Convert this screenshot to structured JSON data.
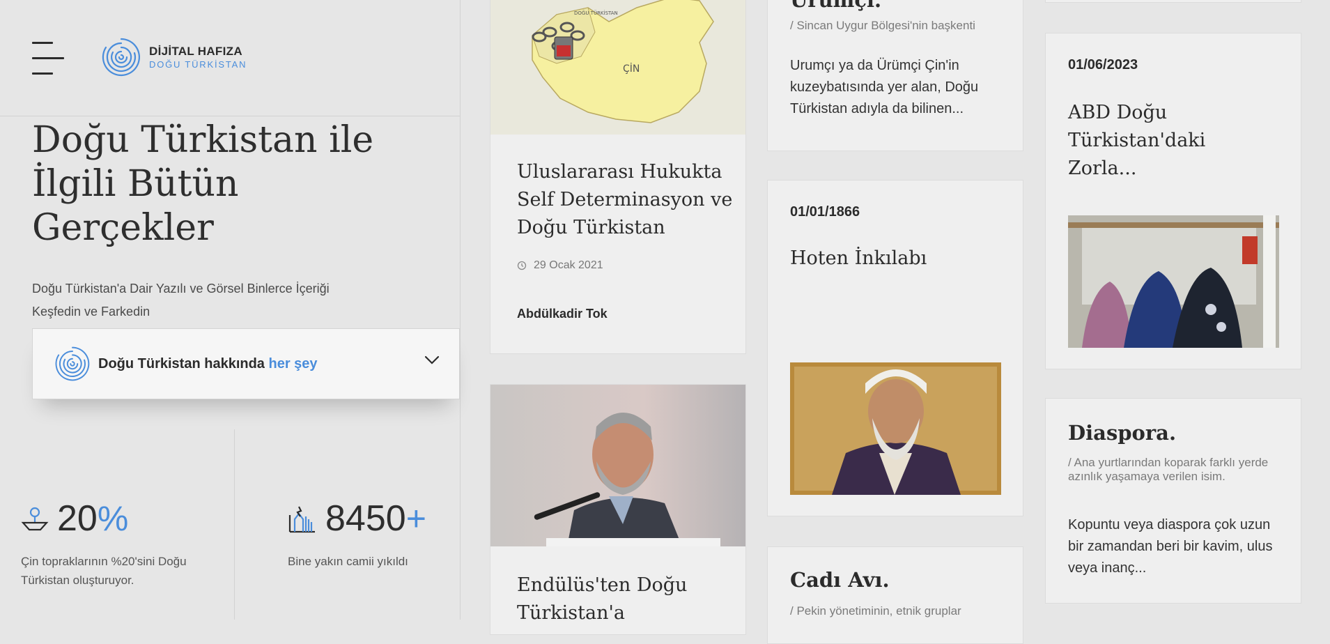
{
  "brand": {
    "name": "DİJİTAL HAFIZA",
    "tagline": "DOĞU TÜRKİSTAN"
  },
  "hero": {
    "title_lines": [
      "Doğu Türkistan ile",
      "İlgili Bütün",
      "Gerçekler"
    ],
    "subtitle": "Doğu Türkistan'a Dair Yazılı ve Görsel Binlerce İçeriği Keşfedin ve Farkedin",
    "search": {
      "prefix": "Doğu Türkistan hakkında",
      "highlight": "her şey"
    }
  },
  "stats": [
    {
      "value": "20",
      "suffix": "%",
      "description": "Çin topraklarının %20'sini Doğu Türkistan oluşturuyor.",
      "icon": "map-pin-icon"
    },
    {
      "value": "8450",
      "suffix": "+",
      "description": "Bine yakın camii yıkıldı",
      "icon": "demolished-building-icon"
    }
  ],
  "articles": [
    {
      "title": "Uluslararası Hukukta Self Determinasyon ve Doğu Türkistan",
      "date": "29 Ocak 2021",
      "author": "Abdülkadir Tok",
      "map_label": "ÇİN",
      "map_tag": "DOĞU TÜRKİSTAN"
    },
    {
      "title": "Endülüs'ten Doğu Türkistan'a"
    }
  ],
  "concepts": [
    {
      "title": "Urumçi.",
      "category": "/ Sincan Uygur Bölgesi'nin başkenti",
      "body": "Urumçı ya da Ürümçi Çin'in kuzeybatısında yer alan, Doğu Türkistan adıyla da bilinen..."
    },
    {
      "title": "Cadı Avı.",
      "category": "/ Pekin yönetiminin, etnik gruplar"
    },
    {
      "title": "Diaspora.",
      "category": "/ Ana yurtlarından koparak farklı yerde azınlık yaşamaya verilen isim.",
      "body": "Kopuntu veya diaspora çok uzun bir zamandan beri bir kavim, ulus veya inanç..."
    }
  ],
  "timeline": [
    {
      "date": "01/01/1866",
      "title": "Hoten İnkılabı"
    },
    {
      "date": "01/06/2023",
      "title": "ABD Doğu Türkistan'daki Zorla..."
    }
  ],
  "colors": {
    "accent": "#4a8ddb",
    "background": "#e6e6e6",
    "card": "#efefef",
    "text": "#2b2b2b"
  }
}
